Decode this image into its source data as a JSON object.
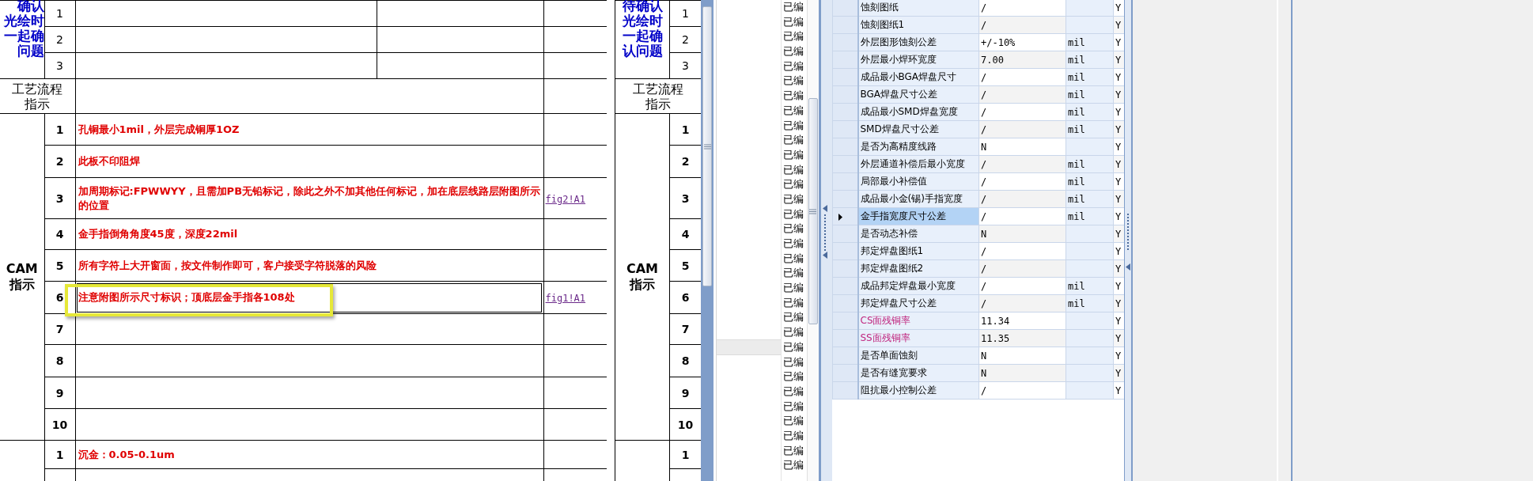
{
  "left_sheet": {
    "pending_label_lines": [
      "确认",
      "光绘时",
      "一起确",
      "问题"
    ],
    "pending_rows": [
      "1",
      "2",
      "3"
    ],
    "process_label_lines": [
      "工艺流程",
      "指示"
    ],
    "cam_label_lines": [
      "CAM",
      "指示"
    ],
    "cam_rows": [
      {
        "no": "1",
        "text": "孔铜最小1mil，外层完成铜厚1OZ",
        "highlighted": false
      },
      {
        "no": "2",
        "text": "此板不印阻焊",
        "highlighted": false
      },
      {
        "no": "3",
        "text": "加周期标记:FPWWYY，且需加PB无铅标记，除此之外不加其他任何标记，加在底层线路层附图所示的位置",
        "link": "fig2!A1",
        "highlighted": false
      },
      {
        "no": "4",
        "text": "金手指倒角角度45度，深度22mil",
        "highlighted": false
      },
      {
        "no": "5",
        "text": "所有字符上大开窗面，按文件制作即可，客户接受字符脱落的风险",
        "highlighted": false
      },
      {
        "no": "6",
        "text": "注意附图所示尺寸标识；顶底层金手指各108处",
        "link": "fig1!A1",
        "highlighted": true
      },
      {
        "no": "7",
        "highlighted": false
      },
      {
        "no": "8",
        "highlighted": false
      },
      {
        "no": "9",
        "highlighted": false
      },
      {
        "no": "10",
        "highlighted": false
      }
    ],
    "next_rows": [
      {
        "no": "1",
        "text": "沉金：0.05-0.1um"
      }
    ]
  },
  "right_sheet": {
    "pending_label_lines": [
      "待确认",
      "光绘时",
      "一起确",
      "认问题"
    ],
    "pending_rows": [
      "1",
      "2",
      "3"
    ],
    "process_label_lines": [
      "工艺流程",
      "指示"
    ],
    "cam_label_lines": [
      "CAM",
      "指示"
    ],
    "cam_rows": [
      "1",
      "2",
      "3",
      "4",
      "5",
      "6",
      "7",
      "8",
      "9",
      "10"
    ],
    "next_rows": [
      "1"
    ]
  },
  "list": {
    "items": [
      "已编",
      "已编",
      "已编",
      "已编",
      "已编",
      "已编",
      "已编",
      "已编",
      "已编",
      "已编",
      "已编",
      "已编",
      "已编",
      "已编",
      "已编",
      "已编",
      "已编",
      "已编",
      "已编",
      "已编",
      "已编",
      "已编",
      "已编",
      "已编",
      "已编",
      "已编",
      "已编",
      "已编",
      "已编",
      "已编",
      "已编",
      "已编"
    ]
  },
  "grid": {
    "rows": [
      {
        "name": "蚀刻图纸",
        "value": "/",
        "flag": "Y",
        "selected": false,
        "kind": "plain"
      },
      {
        "name": "蚀刻图纸1",
        "value": "/",
        "flag": "Y",
        "selected": false,
        "kind": "plain"
      },
      {
        "name": "外层图形蚀刻公差",
        "value": "+/-10%",
        "unit": "mil",
        "flag": "Y",
        "selected": false,
        "kind": "plain"
      },
      {
        "name": "外层最小焊环宽度",
        "value": "7.00",
        "unit": "mil",
        "flag": "Y",
        "selected": false,
        "kind": "plain"
      },
      {
        "name": "成品最小BGA焊盘尺寸",
        "value": "/",
        "unit": "mil",
        "flag": "Y",
        "selected": false,
        "kind": "plain"
      },
      {
        "name": "BGA焊盘尺寸公差",
        "value": "/",
        "unit": "mil",
        "flag": "Y",
        "selected": false,
        "kind": "plain"
      },
      {
        "name": "成品最小SMD焊盘宽度",
        "value": "/",
        "unit": "mil",
        "flag": "Y",
        "selected": false,
        "kind": "plain"
      },
      {
        "name": "SMD焊盘尺寸公差",
        "value": "/",
        "unit": "mil",
        "flag": "Y",
        "selected": false,
        "kind": "plain"
      },
      {
        "name": "是否为高精度线路",
        "value": "N",
        "flag": "Y",
        "selected": false,
        "kind": "plain"
      },
      {
        "name": "外层通道补偿后最小宽度",
        "value": "/",
        "unit": "mil",
        "flag": "Y",
        "selected": false,
        "kind": "plain"
      },
      {
        "name": "局部最小补偿值",
        "value": "/",
        "unit": "mil",
        "flag": "Y",
        "selected": false,
        "kind": "plain"
      },
      {
        "name": "成品最小金(锡)手指宽度",
        "value": "/",
        "unit": "mil",
        "flag": "Y",
        "selected": false,
        "kind": "plain"
      },
      {
        "name": "金手指宽度尺寸公差",
        "value": "/",
        "unit": "mil",
        "flag": "Y",
        "selected": true,
        "kind": "plain"
      },
      {
        "name": "是否动态补偿",
        "value": "N",
        "flag": "Y",
        "selected": false,
        "kind": "plain"
      },
      {
        "name": "邦定焊盘图纸1",
        "value": "/",
        "flag": "Y",
        "selected": false,
        "kind": "plain"
      },
      {
        "name": "邦定焊盘图纸2",
        "value": "/",
        "flag": "Y",
        "selected": false,
        "kind": "plain"
      },
      {
        "name": "成品邦定焊盘最小宽度",
        "value": "/",
        "unit": "mil",
        "flag": "Y",
        "selected": false,
        "kind": "plain"
      },
      {
        "name": "邦定焊盘尺寸公差",
        "value": "/",
        "unit": "mil",
        "flag": "Y",
        "selected": false,
        "kind": "plain"
      },
      {
        "name": "CS面残铜率",
        "value": "11.34",
        "flag": "Y",
        "selected": false,
        "kind": "marked"
      },
      {
        "name": "SS面残铜率",
        "value": "11.35",
        "flag": "Y",
        "selected": false,
        "kind": "marked"
      },
      {
        "name": "是否单面蚀刻",
        "value": "N",
        "flag": "Y",
        "selected": false,
        "kind": "plain"
      },
      {
        "name": "是否有缝宽要求",
        "value": "N",
        "flag": "Y",
        "selected": false,
        "kind": "plain"
      },
      {
        "name": "阻抗最小控制公差",
        "value": "/",
        "flag": "Y",
        "selected": false,
        "kind": "plain"
      }
    ]
  }
}
